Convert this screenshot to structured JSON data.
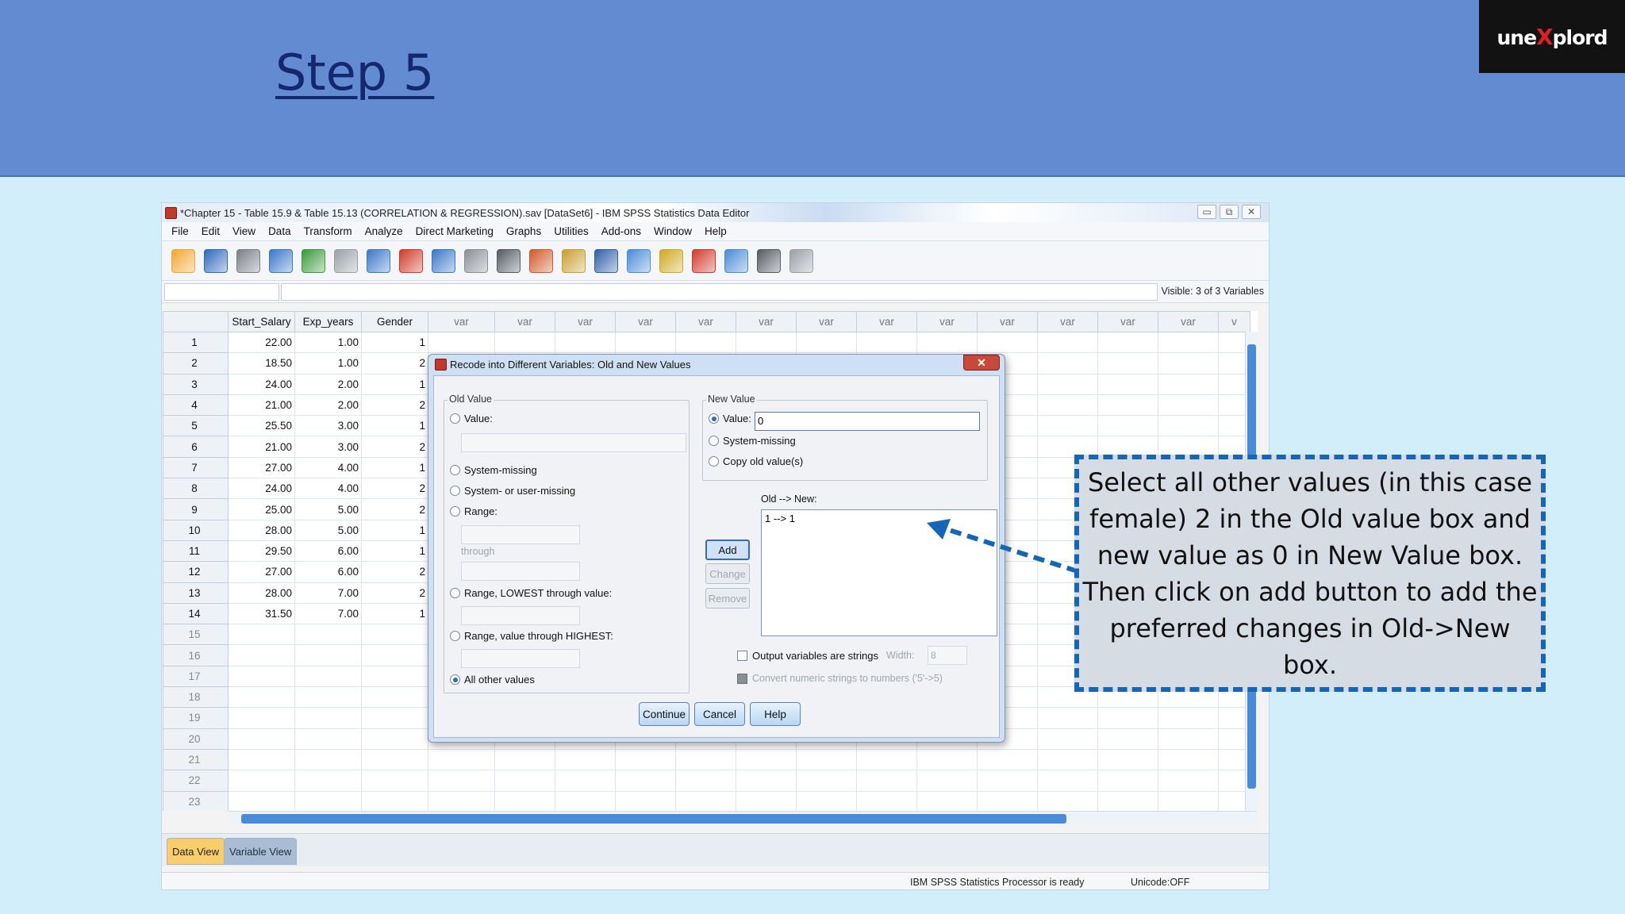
{
  "slide": {
    "title": "Step 5",
    "logo_left": "une",
    "logo_x": "X",
    "logo_right": "plord"
  },
  "window": {
    "title": "*Chapter 15 - Table 15.9 & Table 15.13 (CORRELATION & REGRESSION).sav [DataSet6] - IBM SPSS Statistics Data Editor",
    "controls": [
      "▭",
      "⧉",
      "✕"
    ]
  },
  "menu": [
    "File",
    "Edit",
    "View",
    "Data",
    "Transform",
    "Analyze",
    "Direct Marketing",
    "Graphs",
    "Utilities",
    "Add-ons",
    "Window",
    "Help"
  ],
  "toolbar_icons": [
    {
      "name": "open-folder-icon",
      "color": "#f0a830"
    },
    {
      "name": "save-icon",
      "color": "#2f6bbd"
    },
    {
      "name": "print-icon",
      "color": "#7a7f87"
    },
    {
      "name": "dialog-recall-icon",
      "color": "#3a78c8"
    },
    {
      "name": "undo-icon",
      "color": "#3a9a3a"
    },
    {
      "name": "redo-icon",
      "color": "#9aa0a8"
    },
    {
      "name": "goto-case-icon",
      "color": "#3a78c8"
    },
    {
      "name": "goto-variable-icon",
      "color": "#d03a2a"
    },
    {
      "name": "variables-icon",
      "color": "#3a78c8"
    },
    {
      "name": "run-descriptives-icon",
      "color": "#8a8f96"
    },
    {
      "name": "find-icon",
      "color": "#555b63"
    },
    {
      "name": "insert-cases-icon",
      "color": "#d05a2a"
    },
    {
      "name": "insert-variable-icon",
      "color": "#c8a030"
    },
    {
      "name": "split-file-icon",
      "color": "#2f5fa8"
    },
    {
      "name": "weight-cases-icon",
      "color": "#4a8bd8"
    },
    {
      "name": "select-cases-icon",
      "color": "#d0a820"
    },
    {
      "name": "value-labels-icon",
      "color": "#d03a2a"
    },
    {
      "name": "use-sets-icon",
      "color": "#4a8bd8"
    },
    {
      "name": "show-all-variables-icon",
      "color": "#555b63"
    },
    {
      "name": "spell-check-icon",
      "color": "#9aa0a8"
    }
  ],
  "cellbar": {
    "visible": "Visible: 3 of 3 Variables"
  },
  "grid": {
    "columns": [
      "Start_Salary",
      "Exp_years",
      "Gender",
      "var",
      "var",
      "var",
      "var",
      "var",
      "var",
      "var",
      "var",
      "var",
      "var",
      "var",
      "var",
      "var",
      "v"
    ],
    "rows": [
      [
        "1",
        "22.00",
        "1.00",
        "1"
      ],
      [
        "2",
        "18.50",
        "1.00",
        "2"
      ],
      [
        "3",
        "24.00",
        "2.00",
        "1"
      ],
      [
        "4",
        "21.00",
        "2.00",
        "2"
      ],
      [
        "5",
        "25.50",
        "3.00",
        "1"
      ],
      [
        "6",
        "21.00",
        "3.00",
        "2"
      ],
      [
        "7",
        "27.00",
        "4.00",
        "1"
      ],
      [
        "8",
        "24.00",
        "4.00",
        "2"
      ],
      [
        "9",
        "25.00",
        "5.00",
        "2"
      ],
      [
        "10",
        "28.00",
        "5.00",
        "1"
      ],
      [
        "11",
        "29.50",
        "6.00",
        "1"
      ],
      [
        "12",
        "27.00",
        "6.00",
        "2"
      ],
      [
        "13",
        "28.00",
        "7.00",
        "2"
      ],
      [
        "14",
        "31.50",
        "7.00",
        "1"
      ],
      [
        "15",
        "",
        "",
        ""
      ],
      [
        "16",
        "",
        "",
        ""
      ],
      [
        "17",
        "",
        "",
        ""
      ],
      [
        "18",
        "",
        "",
        ""
      ],
      [
        "19",
        "",
        "",
        ""
      ],
      [
        "20",
        "",
        "",
        ""
      ],
      [
        "21",
        "",
        "",
        ""
      ],
      [
        "22",
        "",
        "",
        ""
      ],
      [
        "23",
        "",
        "",
        ""
      ]
    ]
  },
  "tabs": {
    "data_view": "Data View",
    "variable_view": "Variable View"
  },
  "status": {
    "processor": "IBM SPSS Statistics Processor is ready",
    "unicode": "Unicode:OFF"
  },
  "dialog": {
    "title": "Recode into Different Variables: Old and New Values",
    "old_value": {
      "label": "Old Value",
      "value": "Value:",
      "system_missing": "System-missing",
      "system_or_user_missing": "System- or user-missing",
      "range": "Range:",
      "through": "through",
      "range_lowest": "Range, LOWEST through value:",
      "range_highest": "Range, value through HIGHEST:",
      "all_other": "All other values"
    },
    "new_value": {
      "label": "New Value",
      "value": "Value:",
      "value_input": "0",
      "system_missing": "System-missing",
      "copy_old": "Copy old value(s)"
    },
    "old_new_label": "Old --> New:",
    "old_new_items": [
      "1 --> 1"
    ],
    "buttons": {
      "add": "Add",
      "change": "Change",
      "remove": "Remove",
      "continue": "Continue",
      "cancel": "Cancel",
      "help": "Help"
    },
    "output_strings": "Output variables are strings",
    "width_label": "Width:",
    "width_value": "8",
    "convert_numeric": "Convert numeric strings to numbers ('5'->5)"
  },
  "callout": {
    "text": "Select all other values (in this case female) 2 in the Old value box and new value as 0 in New Value box. Then click on add button to add the preferred changes in Old->New box."
  },
  "colors": {
    "header_bg": "#628bd2",
    "title_color": "#13286f",
    "callout_border": "#1566b6",
    "accent": "#4a8bd8"
  }
}
